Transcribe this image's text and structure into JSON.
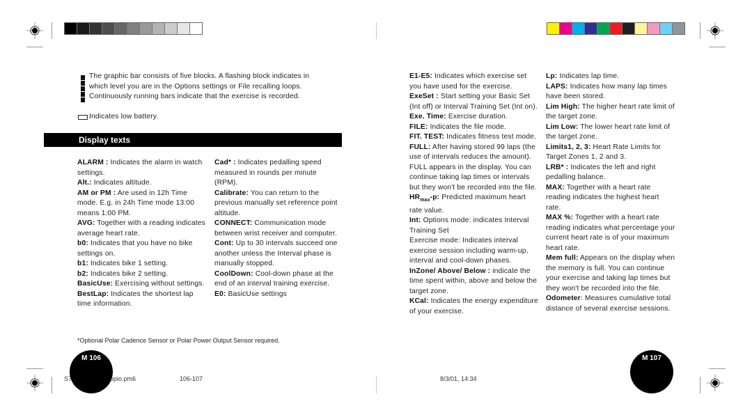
{
  "gray_swatches": [
    "#000000",
    "#1a1a1a",
    "#333333",
    "#4d4d4d",
    "#666666",
    "#808080",
    "#999999",
    "#b3b3b3",
    "#cccccc",
    "#e6e6e6",
    "#ffffff"
  ],
  "color_swatches": [
    "#fff200",
    "#ec008c",
    "#00aeef",
    "#2e3192",
    "#00a651",
    "#ed1c24",
    "#231f20",
    "#fff799",
    "#f49ac1",
    "#6dcff6",
    "#939598"
  ],
  "intro": {
    "graphic_bar_text": "The graphic bar consists of five blocks. A flashing block indicates in which level you are in the Options settings or File recalling loops. Continuously running bars indicate that the exercise is recorded.",
    "battery_text": "Indicates low battery."
  },
  "section_title": "Display texts",
  "columns": [
    [
      {
        "term": "ALARM :",
        "text": " Indicates the alarm in watch settings."
      },
      {
        "term": "Alt.:",
        "text": " Indicates altitude."
      },
      {
        "term": "AM or PM :",
        "text": " Are used in 12h Time mode. E.g. in 24h Time mode 13:00 means 1:00 PM."
      },
      {
        "term": "AVG:",
        "text": " Together with a reading indicates average heart rate."
      },
      {
        "term": "b0:",
        "text": " Indicates that you have no bike settings on."
      },
      {
        "term": "b1:",
        "text": " Indicates bike 1 setting."
      },
      {
        "term": "b2:",
        "text": " Indicates bike 2 setting."
      },
      {
        "term": "BasicUse:",
        "text": " Exercising without settings."
      },
      {
        "term": "BestLap:",
        "text": " Indicates the shortest lap time information."
      }
    ],
    [
      {
        "term": "Cad* :",
        "text": " Indicates pedalling speed measured in rounds per minute (RPM)."
      },
      {
        "term": "Calibrate:",
        "text": " You can return to the previous manually set reference point altitude."
      },
      {
        "term": "CONNECT:",
        "text": " Communication mode between wrist receiver and computer."
      },
      {
        "term": "Cont:",
        "text": " Up to 30 intervals succeed one another unless the Interval phase is manually stopped."
      },
      {
        "term": "CoolDown:",
        "text": " Cool-down phase at the end of an interval training exercise."
      },
      {
        "term": "E0:",
        "text": " BasicUse settings"
      }
    ],
    [
      {
        "term": "E1-E5:",
        "text": " Indicates which exercise set you have used for the exercise."
      },
      {
        "term": "ExeSet :",
        "text": " Start setting your Basic Set (Int off) or Interval Training Set (Int on)."
      },
      {
        "term": "Exe. Time:",
        "text": " Exercise duration."
      },
      {
        "term": "FILE:",
        "text": " Indicates the file mode."
      },
      {
        "term": "FIT. TEST:",
        "text": " Indicates fitness test mode."
      },
      {
        "term": "FULL:",
        "text": " After having stored 99 laps (the use of intervals reduces the amount). FULL appears in the display. You can continue taking lap times or intervals but they won't be recorded into the file."
      },
      {
        "term": "HRmax-p:",
        "text": " Predicted maximum heart rate value."
      },
      {
        "term": "Int:",
        "text": " Options mode: indicates Interval Training Set"
      },
      {
        "term": "",
        "text": "Exercise mode: Indicates interval exercise session including warm-up, interval and cool-down phases."
      },
      {
        "term": "InZone/ Above/ Below :",
        "text": " indicate the time spent within, above and below the target zone."
      },
      {
        "term": "KCal:",
        "text": " Indicates the energy expenditure of your exercise."
      }
    ],
    [
      {
        "term": "Lp:",
        "text": " Indicates lap time."
      },
      {
        "term": "LAPS:",
        "text": " Indicates how many lap times have been stored."
      },
      {
        "term": "Lim High:",
        "text": " The higher heart rate limit of the target zone."
      },
      {
        "term": "Lim Low:",
        "text": " The lower heart rate limit of the target zone."
      },
      {
        "term": "Limits1, 2, 3:",
        "text": " Heart Rate Limits for Target Zones 1, 2 and 3."
      },
      {
        "term": "LRB* :",
        "text": " Indicates the left and right pedalling balance."
      },
      {
        "term": "MAX:",
        "text": " Together with a heart rate reading indicates the highest heart rate."
      },
      {
        "term": "MAX %:",
        "text": " Together with a heart rate reading indicates what percentage your current heart rate is of your maximum heart rate."
      },
      {
        "term": "Mem full:",
        "text": " Appears on the display when the memory is full. You can continue your exercise and taking lap times but they won't be recorded into the file."
      },
      {
        "term": "Odometer",
        "text": ": Measures cumulative total distance of several exercise sessions."
      }
    ]
  ],
  "footnote": "*Optional Polar Cadence Sensor or Polar Power Output Sensor required.",
  "page_left": "M 106",
  "page_right": "M 107",
  "slug": {
    "file_start": "S7",
    "file_end": "opio.pm6",
    "pages": "106-107",
    "datetime": "8/3/01, 14:34"
  }
}
